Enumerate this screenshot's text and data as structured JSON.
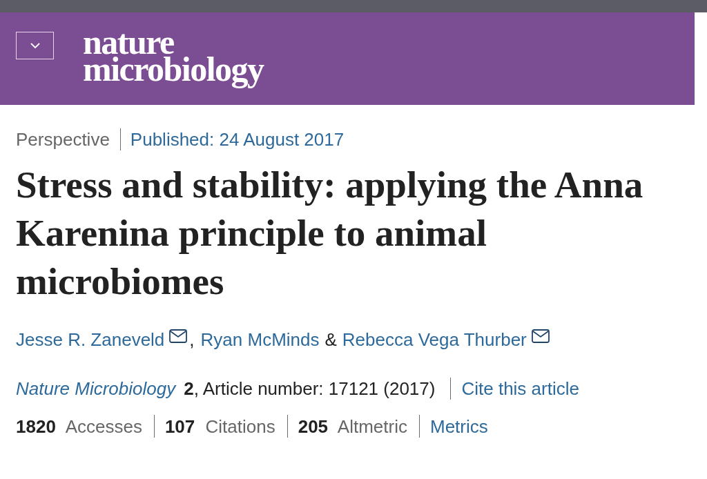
{
  "header": {
    "logo": [
      "nature",
      "microbiology"
    ]
  },
  "article_info": {
    "type": "Perspective",
    "published": "Published: 24 August 2017"
  },
  "title": "Stress and stability: applying the Anna Karenina principle to animal microbiomes",
  "authors": [
    {
      "name": "Jesse R. Zaneveld",
      "email": true,
      "separator": ","
    },
    {
      "name": "Ryan McMinds",
      "email": false,
      "separator": "&"
    },
    {
      "name": "Rebecca Vega Thurber",
      "email": true
    }
  ],
  "citation": {
    "journal": "Nature Microbiology",
    "details": "**2**, Article number: 17121 (2017)",
    "cite_link": "Cite this article"
  },
  "metrics": [
    "**1820** Accesses",
    "**107** Citations",
    "**205** Altmetric"
  ],
  "metrics_link": "Metrics"
}
